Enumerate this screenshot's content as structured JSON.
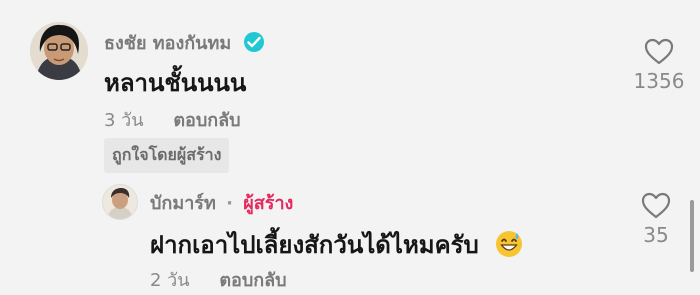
{
  "comments": [
    {
      "author": "ธงชัย ทองกันทม",
      "verified": true,
      "text": "หลานชั้นนนน",
      "time": "3 วัน",
      "reply_label": "ตอบกลับ",
      "liked_by_creator": "ถูกใจโดยผู้สร้าง",
      "like_count": "1356",
      "avatar_icon": "person-avatar-icon"
    },
    {
      "author": "บักมาร์ท",
      "separator": "·",
      "creator_badge": "ผู้สร้าง",
      "text": "ฝากเอาไปเลี้ยงสักวันได้ไหมครับ",
      "emoji": "grinning-sweat-emoji",
      "time": "2 วัน",
      "reply_label": "ตอบกลับ",
      "like_count": "35",
      "avatar_icon": "person-avatar-icon"
    }
  ],
  "colors": {
    "background": "#f3f3f3",
    "verified_badge": "#20c8d3",
    "creator_badge": "#e32a5f",
    "primary_text": "#161616",
    "secondary_text": "#8a8a8a"
  }
}
